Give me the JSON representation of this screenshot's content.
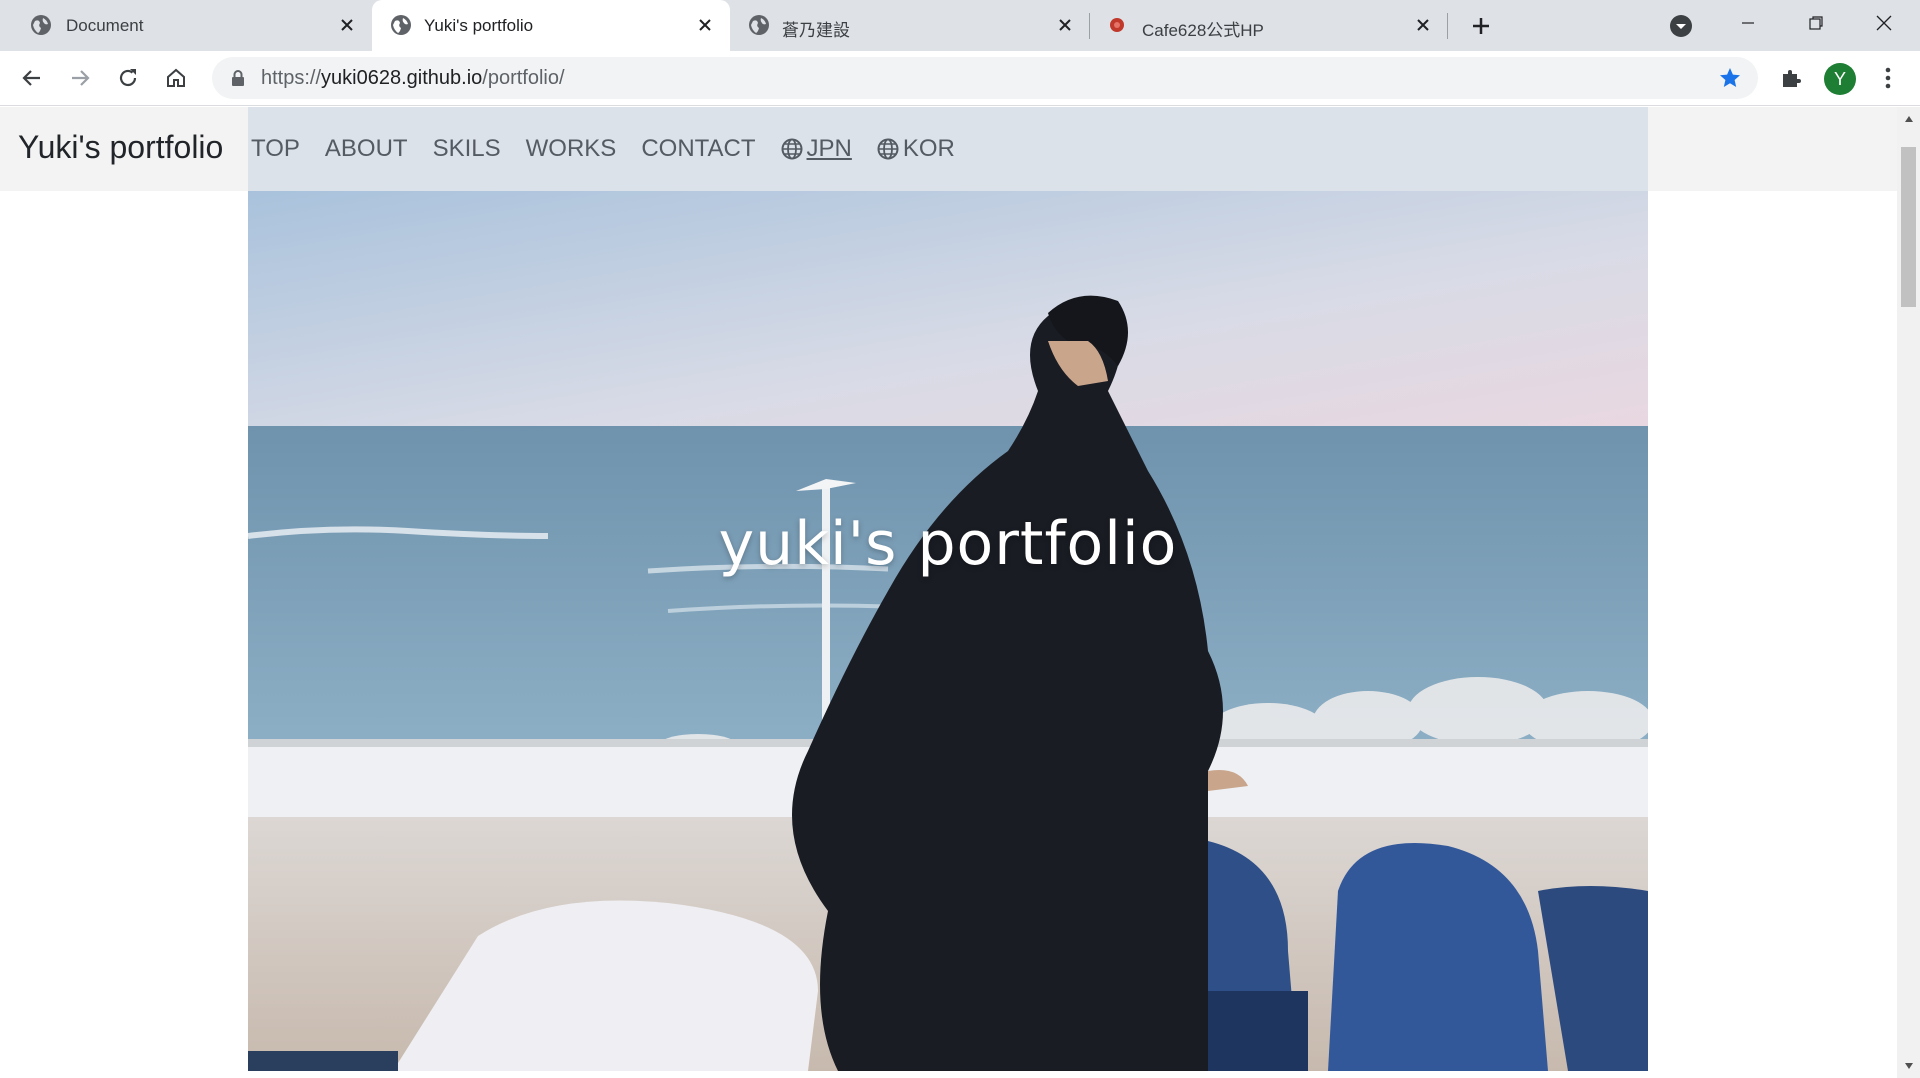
{
  "browser": {
    "tabs": [
      {
        "title": "Document",
        "active": false
      },
      {
        "title": "Yuki's portfolio",
        "active": true
      },
      {
        "title": "蒼乃建設",
        "active": false
      },
      {
        "title": "Cafe628公式HP",
        "active": false
      }
    ],
    "url_scheme": "https://",
    "url_host": "yuki0628.github.io",
    "url_path": "/portfolio/",
    "profile_initial": "Y",
    "accent_color": "#1a73e8",
    "profile_color": "#1e7e34"
  },
  "site": {
    "brand": "Yuki's portfolio",
    "nav": [
      {
        "label": "TOP"
      },
      {
        "label": "ABOUT"
      },
      {
        "label": "SKILS"
      },
      {
        "label": "WORKS"
      },
      {
        "label": "CONTACT"
      },
      {
        "label": "JPN",
        "icon": "globe-icon",
        "active": true
      },
      {
        "label": "KOR",
        "icon": "globe-icon",
        "active": false
      }
    ],
    "hero_title": "yuki's portfolio"
  }
}
